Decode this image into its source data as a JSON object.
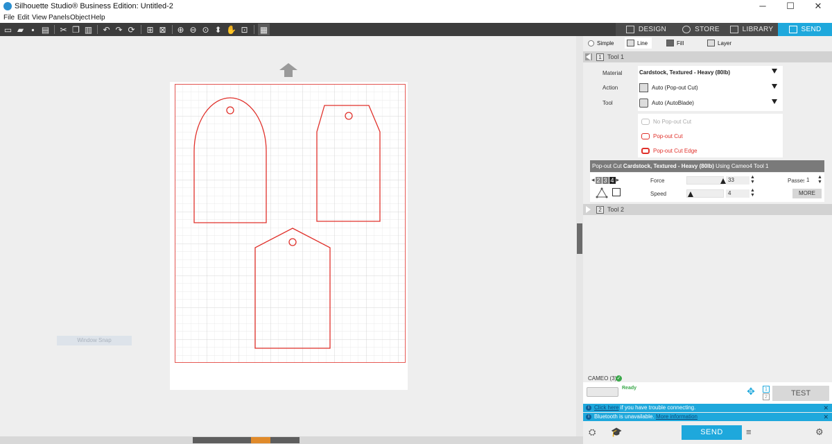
{
  "window": {
    "title": "Silhouette Studio® Business Edition: Untitled-2",
    "controls": {
      "minimize": "─",
      "maximize": "☐",
      "close": "✕"
    }
  },
  "menu": [
    "File",
    "Edit",
    "View",
    "Panels",
    "Object",
    "Help"
  ],
  "tabs": {
    "design": "DESIGN",
    "store": "STORE",
    "library": "LIBRARY",
    "send": "SEND"
  },
  "canvas": {
    "window_snap": "Window Snap",
    "cut_color": "#e0302a"
  },
  "send_panel": {
    "modes": {
      "simple": "Simple",
      "line": "Line",
      "fill": "Fill",
      "layer": "Layer"
    },
    "tool1": {
      "number": "1",
      "label": "Tool 1"
    },
    "tool2": {
      "number": "2",
      "label": "Tool 2"
    },
    "labels": {
      "material": "Material",
      "action": "Action",
      "tool": "Tool"
    },
    "material": "Cardstock, Textured - Heavy (80lb)",
    "action": "Auto (Pop-out Cut)",
    "tool": "Auto (AutoBlade)",
    "popout_options": [
      "No Pop-out Cut",
      "Pop-out Cut",
      "Pop-out Cut Edge"
    ],
    "settings_header": {
      "prefix": "Pop-out Cut ",
      "material": "Cardstock, Textured - Heavy (80lb)",
      "suffix": " Using Cameo4 Tool 1"
    },
    "blade_digits": [
      "2",
      "3",
      "4"
    ],
    "force": {
      "label": "Force",
      "value": "33",
      "fraction": 0.97
    },
    "speed": {
      "label": "Speed",
      "value": "4",
      "fraction": 0.1
    },
    "passes": {
      "label": "Passes",
      "value": "1"
    },
    "more_button": "MORE"
  },
  "device": {
    "name": "CAMEO (3)",
    "status": "Ready",
    "test_button": "TEST",
    "info1": {
      "link": "Click here",
      "text": " if you have trouble connecting."
    },
    "info2": {
      "text": "Bluetooth is unavailable. ",
      "link": "More information"
    },
    "send_button": "SEND"
  },
  "colors": {
    "accent": "#1ea8dc",
    "toolbar": "#3c3c3c",
    "cut": "#e0302a"
  }
}
